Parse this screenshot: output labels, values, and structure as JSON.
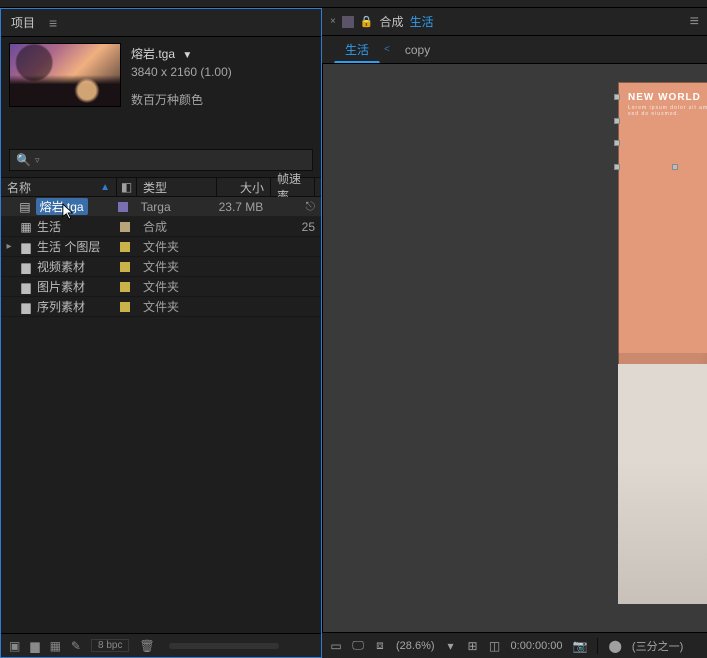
{
  "projectPanel": {
    "tabLabel": "项目",
    "asset": {
      "name": "熔岩.tga",
      "dims": "3840 x 2160 (1.00)",
      "colors": "数百万种颜色"
    },
    "searchPlaceholder": "",
    "columns": {
      "name": "名称",
      "type": "类型",
      "size": "大小",
      "fps": "帧速率"
    },
    "rows": [
      {
        "twisty": "",
        "iconGlyph": "▤",
        "iconName": "footage-icon",
        "name": "熔岩.tga",
        "labelColor": "#7a6fb0",
        "type": "Targa",
        "size": "23.7 MB",
        "fps": "",
        "selected": true,
        "tail": "⎋"
      },
      {
        "twisty": "",
        "iconGlyph": "▦",
        "iconName": "comp-icon",
        "name": "生活",
        "labelColor": "#b8a37a",
        "type": "合成",
        "size": "",
        "fps": "25",
        "selected": false,
        "tail": ""
      },
      {
        "twisty": "▸",
        "iconGlyph": "▆",
        "iconName": "folder-icon",
        "name": "生活 个图层",
        "labelColor": "#c9b24a",
        "type": "文件夹",
        "size": "",
        "fps": "",
        "selected": false,
        "tail": ""
      },
      {
        "twisty": "",
        "iconGlyph": "▆",
        "iconName": "folder-icon",
        "name": "视频素材",
        "labelColor": "#c9b24a",
        "type": "文件夹",
        "size": "",
        "fps": "",
        "selected": false,
        "tail": ""
      },
      {
        "twisty": "",
        "iconGlyph": "▆",
        "iconName": "folder-icon",
        "name": "图片素材",
        "labelColor": "#c9b24a",
        "type": "文件夹",
        "size": "",
        "fps": "",
        "selected": false,
        "tail": ""
      },
      {
        "twisty": "",
        "iconGlyph": "▆",
        "iconName": "folder-icon",
        "name": "序列素材",
        "labelColor": "#c9b24a",
        "type": "文件夹",
        "size": "",
        "fps": "",
        "selected": false,
        "tail": ""
      }
    ],
    "footer": {
      "bpc": "8 bpc"
    }
  },
  "compPanel": {
    "headerLabel": "合成",
    "headerLink": "生活",
    "crumbs": {
      "active": "生活",
      "inactive": "copy"
    },
    "poster": {
      "heading": "NEW WORLD"
    }
  },
  "viewerFooter": {
    "zoom": "(28.6%)",
    "timecode": "0:00:00:00",
    "viewMode": "(三分之一)"
  }
}
